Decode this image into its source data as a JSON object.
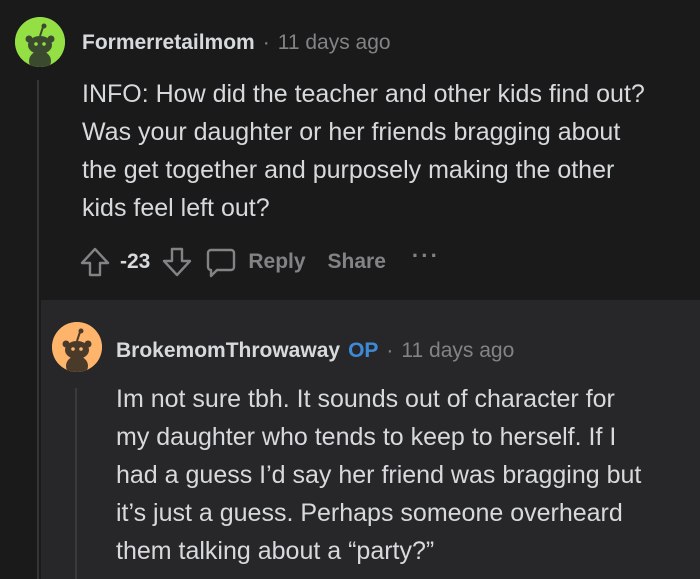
{
  "top_comment": {
    "username": "Formerretailmom",
    "separator": "·",
    "time": "11 days ago",
    "avatar_color": "#94e044",
    "body_lines": [
      "INFO: How did the teacher and other kids find out?",
      "Was your daughter or her friends bragging about",
      "the get together and purposely making the other",
      "kids feel left out?"
    ],
    "actions": {
      "upvote_icon": "upvote-icon",
      "score": "-23",
      "downvote_icon": "downvote-icon",
      "reply_icon": "comment-bubble-icon",
      "reply_label": "Reply",
      "share_label": "Share",
      "more_label": "···"
    }
  },
  "reply_comment": {
    "username": "BrokemomThrowaway",
    "op_badge": "OP",
    "separator": "·",
    "time": "11 days ago",
    "avatar_color": "#ffb46b",
    "body_lines": [
      "Im not sure tbh. It sounds out of character for",
      "my daughter who tends to keep to herself. If I",
      "had a guess I’d say her friend was bragging but",
      "it’s just a guess. Perhaps someone overheard",
      "them talking about a “party?”"
    ]
  },
  "colors": {
    "background": "#1a1a1b",
    "reply_background": "#272729",
    "text_primary": "#d7dadc",
    "text_muted": "#818384",
    "op_blue": "#3d8bd6"
  }
}
